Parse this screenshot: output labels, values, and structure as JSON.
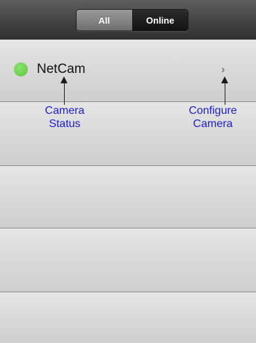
{
  "filter": {
    "all_label": "All",
    "online_label": "Online"
  },
  "cameras": [
    {
      "name": "NetCam",
      "status_color": "#5cc63e"
    }
  ],
  "annotations": {
    "status": {
      "line1": "Camera",
      "line2": "Status"
    },
    "configure": {
      "line1": "Configure",
      "line2": "Camera"
    }
  },
  "colors": {
    "annotation_text": "#2020c8",
    "status_online": "#5cc63e"
  },
  "icons": {
    "status": "status-dot-icon",
    "disclosure": "chevron-right-icon"
  }
}
